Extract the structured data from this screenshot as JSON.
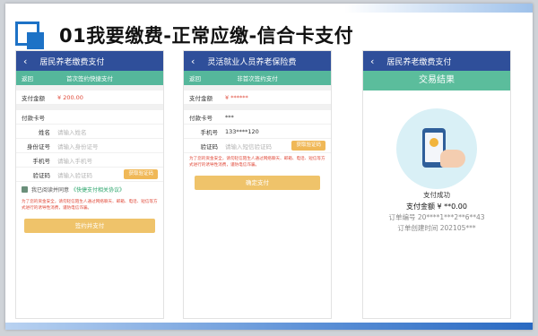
{
  "slide_title": "01我要缴费-正常应缴-信合卡支付",
  "phone1": {
    "back": "‹",
    "topbar_title": "居民养老缴费支付",
    "sub_back": "返回",
    "sub_title": "首次签约快捷支付",
    "amount_label": "支付金额",
    "amount_value": "¥ 200.00",
    "card_label": "付款卡号",
    "name_label": "姓名",
    "name_placeholder": "请输入姓名",
    "id_label": "身份证号",
    "id_placeholder": "请输入身份证号",
    "phone_label": "手机号",
    "phone_placeholder": "请输入手机号",
    "code_label": "验证码",
    "code_placeholder": "请输入验证码",
    "code_button": "获取验证码",
    "agree_text": "我已阅读并同意",
    "agree_link": "《快捷支付相关协议》",
    "warning": "为了您的资金安全，请勿轻信陌生人通过网络聊天、邮箱、电话、短信等方式进行的诱导性消费，谨防电信诈骗。",
    "pay_button": "签约并支付"
  },
  "phone2": {
    "back": "‹",
    "topbar_title": "灵活就业人员养老保险费",
    "sub_back": "返回",
    "sub_title": "非首次签约支付",
    "amount_label": "支付金额",
    "amount_value": "¥ ******",
    "card_label": "付款卡号",
    "card_value": "***",
    "phone_label": "手机号",
    "phone_value": "133****120",
    "code_label": "验证码",
    "code_placeholder": "请输入短信验证码",
    "code_button": "获取验证码",
    "warning": "为了您的资金安全，请勿轻信陌生人通过网络聊天、邮箱、电话、短信等方式进行的诱导性消费，谨防电信诈骗。",
    "confirm_button": "确定支付"
  },
  "phone3": {
    "back": "‹",
    "topbar_title": "居民养老缴费支付",
    "result_header": "交易结果",
    "success_text": "支付成功",
    "amount_line": "支付金额 ¥ **0.00",
    "order_no": "订单编号 20****1***2**6**43",
    "order_time": "订单创建时间 202105***"
  }
}
